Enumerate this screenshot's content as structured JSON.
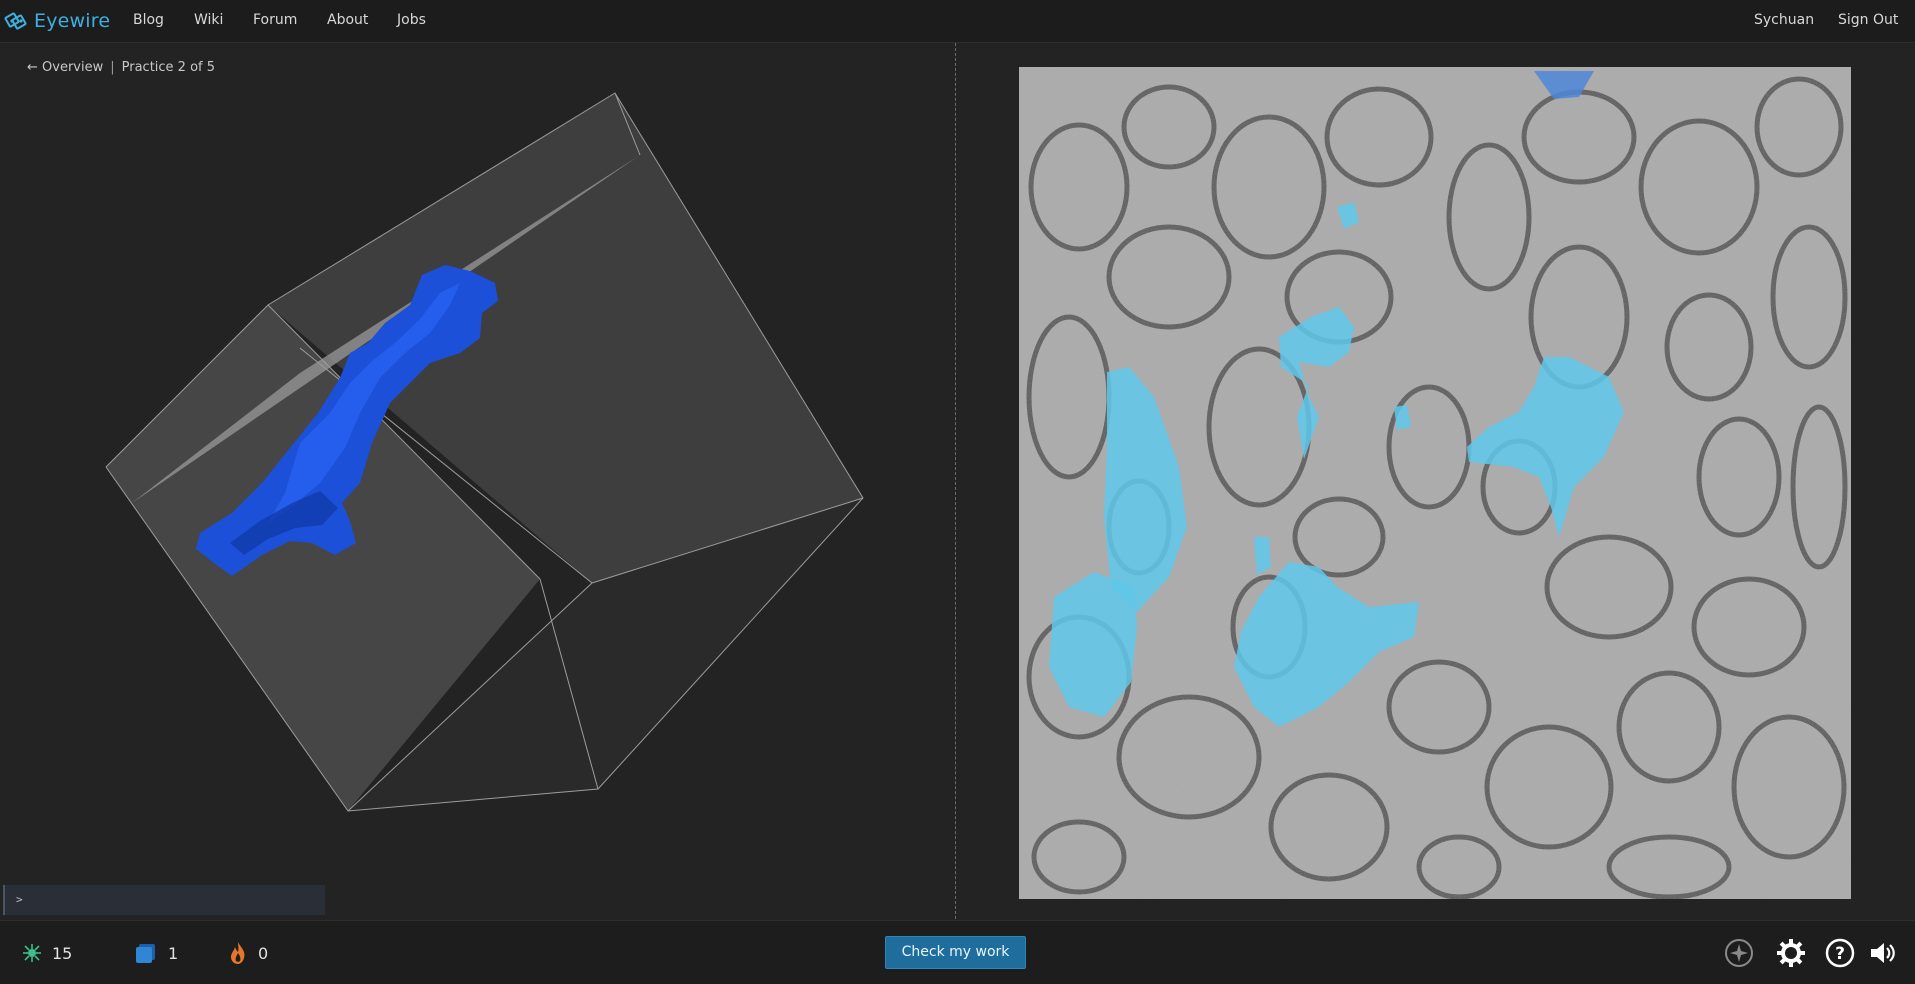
{
  "app": {
    "name": "Eyewire",
    "accent_color": "#3eb0e0"
  },
  "nav": {
    "links": [
      "Blog",
      "Wiki",
      "Forum",
      "About",
      "Jobs"
    ],
    "username": "Sychuan",
    "signout_label": "Sign Out"
  },
  "breadcrumb": {
    "back_label": "← Overview",
    "practice_label": "Practice 2 of 5"
  },
  "viewer3d": {
    "segment_color": "#1a4fd6",
    "icon": "cube-wireframe"
  },
  "console": {
    "prompt": ">"
  },
  "em_view": {
    "highlight_color": "#5fc8ea"
  },
  "stats": {
    "points": "15",
    "cubes": "1",
    "streak": "0",
    "points_icon": "neuron-icon",
    "cubes_icon": "cube-icon",
    "streak_icon": "flame-icon"
  },
  "actions": {
    "check_label": "Check my work"
  },
  "tools": [
    "compass-icon",
    "gear-icon",
    "help-icon",
    "sound-icon"
  ]
}
